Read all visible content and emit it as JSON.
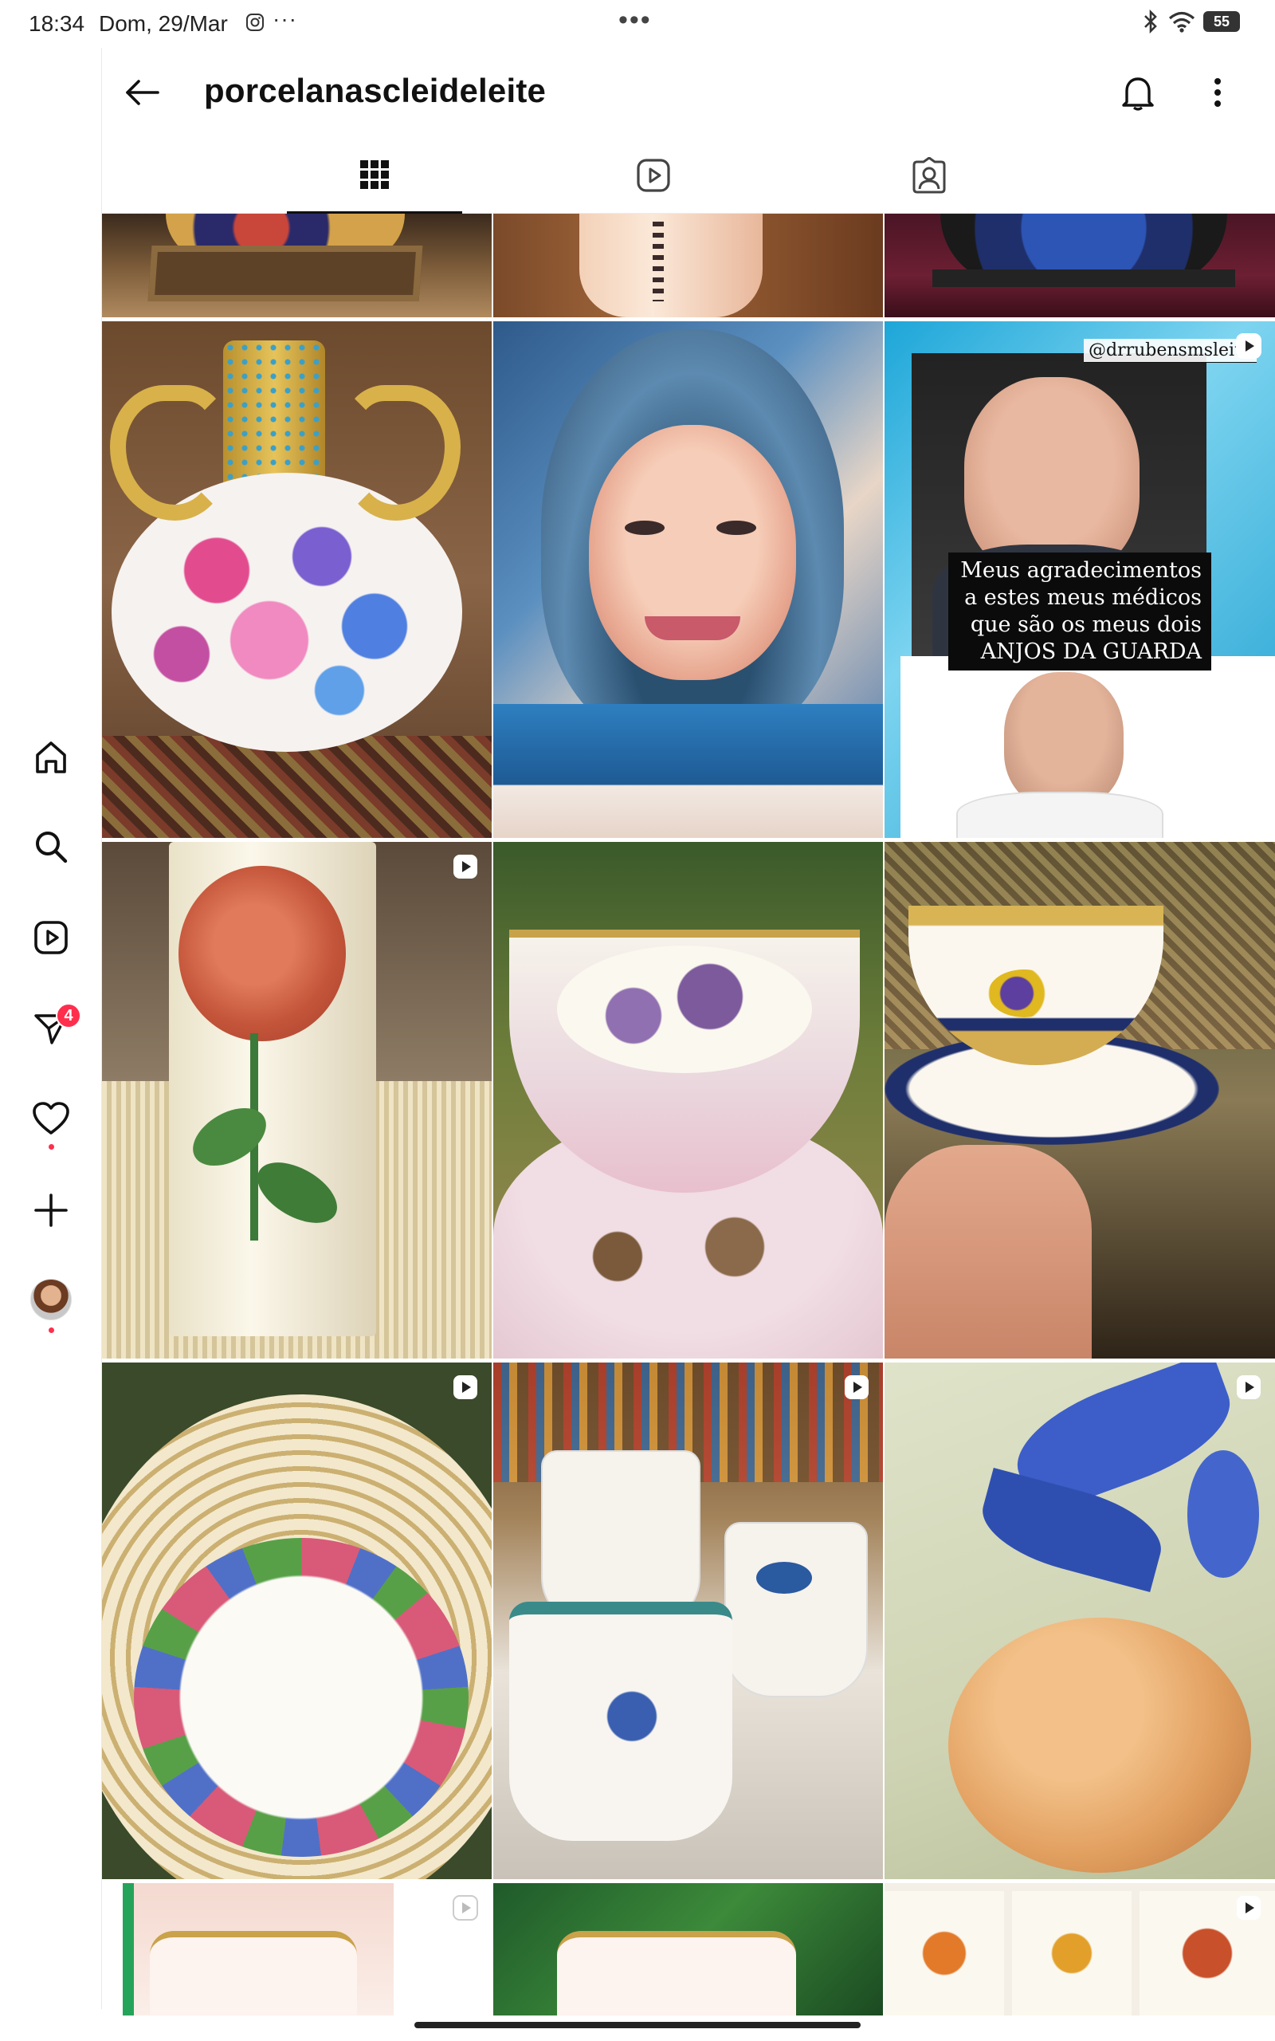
{
  "status_bar": {
    "time": "18:34",
    "date": "Dom, 29/Mar",
    "more": "···",
    "center_dots": "•••",
    "battery": "55"
  },
  "header": {
    "username": "porcelanascleideleite"
  },
  "rail": {
    "direct_badge": "4"
  },
  "posts": {
    "post_top_right_video": {
      "handle": "@drrubensmsleite",
      "caption": "Meus agradecimentos a estes meus médicos que são os meus dois ANJOS DA GUARDA"
    }
  },
  "colors": {
    "accent_badge": "#ff2e4d",
    "text": "#111111"
  },
  "icons": [
    "back-arrow-icon",
    "bell-icon",
    "kebab-icon",
    "grid-icon",
    "reels-icon",
    "tagged-icon",
    "home-icon",
    "search-icon",
    "reels-nav-icon",
    "direct-icon",
    "heart-icon",
    "create-icon",
    "reel-indicator-icon"
  ]
}
